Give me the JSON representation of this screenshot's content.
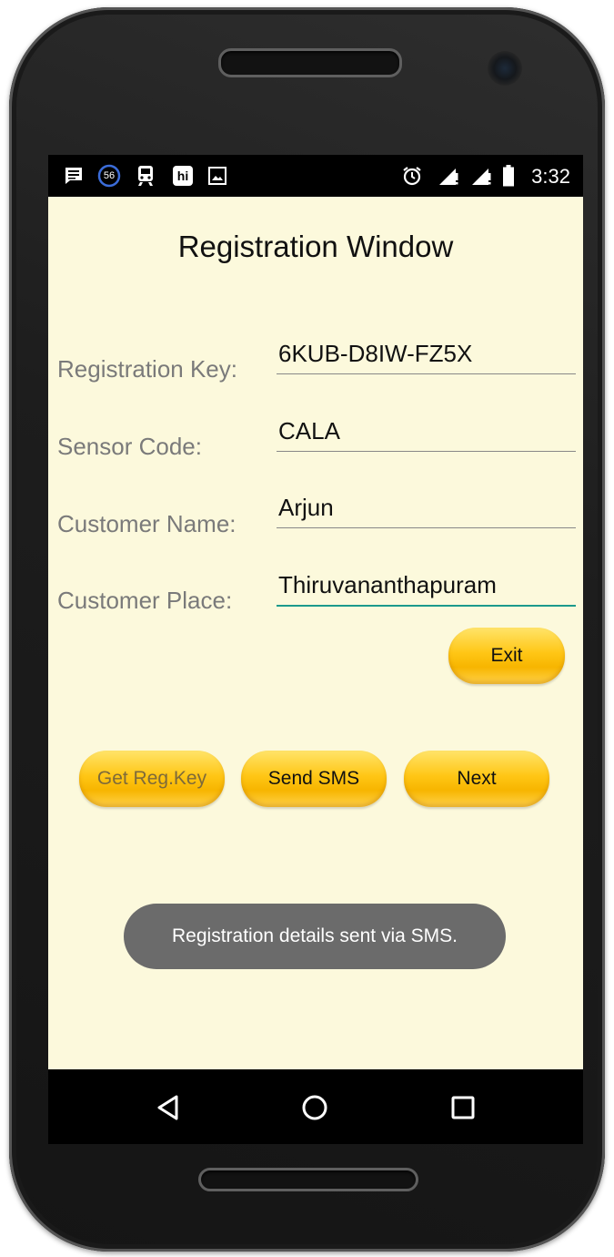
{
  "status_bar": {
    "time": "3:32",
    "notification_badge": "56",
    "hi_label": "hi",
    "icons_left": [
      "message-icon",
      "circle-56-icon",
      "train-icon",
      "hi-app-icon",
      "image-icon"
    ],
    "icons_right": [
      "alarm-icon",
      "signal-icon",
      "signal-icon",
      "battery-icon"
    ]
  },
  "screen": {
    "title": "Registration Window",
    "fields": [
      {
        "label": "Registration Key:",
        "value": "6KUB-D8IW-FZ5X"
      },
      {
        "label": "Sensor Code:",
        "value": "CALA"
      },
      {
        "label": "Customer Name:",
        "value": "Arjun"
      },
      {
        "label": "Customer Place:",
        "value": "Thiruvananthapuram"
      }
    ],
    "buttons": {
      "exit": "Exit",
      "get_reg_key": "Get Reg.Key",
      "send_sms": "Send SMS",
      "next": "Next"
    },
    "toast": "Registration details sent via SMS."
  },
  "colors": {
    "screen_bg": "#FCF9DC",
    "button": "#FFC615",
    "focus_line": "#1c9a8c",
    "toast_bg": "#6b6b6b"
  },
  "nav_bar": {
    "icons": [
      "back-icon",
      "home-icon",
      "recents-icon"
    ]
  }
}
